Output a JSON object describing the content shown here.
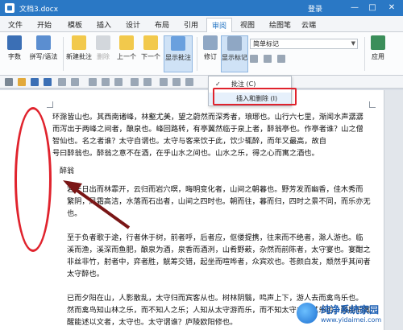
{
  "titlebar": {
    "doc_title": "文档3.docx",
    "login_label": "登录",
    "minimize": "—",
    "maximize": "□",
    "close": "✕"
  },
  "menu": {
    "tabs": [
      "文件",
      "开始",
      "模板",
      "插入",
      "设计",
      "布局",
      "引用",
      "审阅",
      "视图",
      "绘图笔",
      "云端"
    ],
    "active": "审阅"
  },
  "ribbon": {
    "buttons": [
      {
        "label": "字数",
        "icon": "word-count-icon"
      },
      {
        "label": "拼写/语法",
        "icon": "spell-check-icon"
      },
      {
        "label": "新建批注",
        "icon": "new-comment-icon"
      },
      {
        "label": "删除",
        "icon": "delete-comment-icon"
      },
      {
        "label": "上一个",
        "icon": "previous-comment-icon"
      },
      {
        "label": "下一个",
        "icon": "next-comment-icon"
      },
      {
        "label": "显示批注",
        "icon": "show-comments-icon"
      },
      {
        "label": "修订",
        "icon": "track-changes-icon"
      },
      {
        "label": "显示标记",
        "icon": "show-markup-icon"
      },
      {
        "label": "应用",
        "icon": "accept-icon"
      }
    ],
    "markup_select_value": "简单标记"
  },
  "dropdown": {
    "items": [
      {
        "label": "批注 (C)",
        "checked": true
      },
      {
        "label": "插入和删除 (I)",
        "checked": false
      }
    ]
  },
  "document": {
    "para1": [
      "环滁皆山也。其西南诸峰，林壑尤美，望之蔚然而深秀者，琅琊也。山行六七里，渐闻水声潺潺",
      "而泻出于两峰之间者，酿泉也。峰回路转，有亭翼然临于泉上者，醉翁亭也。作亭者谁？山之僧",
      "智仙也。名之者谁？太守自谓也。太守与客来饮于此，饮少辄醉，而年又最高，故自",
      "号曰醉翁也。醉翁之意不在酒，在乎山水之间也。山水之乐，得之心而寓之酒也。"
    ],
    "signature": "醉翁",
    "para2": [
      "若夫日出而林霏开，云归而岩穴暝，晦明变化者，山间之朝暮也。野芳发而幽香，佳木秀而",
      "繁阴，风霜高洁，水落而石出者，山间之四时也。朝而往，暮而归，四时之景不同，而乐亦无穷",
      "也。"
    ],
    "para3": [
      "至于负者歌于途，行者休于树，前者呼，后者应，伛偻提携，往来而不绝者，滁人游也。临",
      "溪而渔，溪深而鱼肥，酿泉为酒，泉香而酒洌，山肴野蔌，杂然而前陈者，太守宴也。宴酣之乐，",
      "非丝非竹，射者中，弈者胜，觥筹交错，起坐而喧哗者，众宾欢也。苍颜白发，颓然乎其间者，",
      "太守醉也。"
    ],
    "para4": [
      "已而夕阳在山，人影散乱，太守归而宾客从也。树林阴翳，鸣声上下，游人去而禽鸟乐也。",
      "然而禽鸟知山林之乐，而不知人之乐；人知从太守游而乐，而不知太守之乐其乐也。醉能同其乐，",
      "醒能述以文者，太守也。太守谓谁？庐陵欧阳修也。"
    ]
  },
  "watermark": {
    "name": "纯净系统家园",
    "url": "www.yidaimei.com"
  },
  "colors": {
    "titlebar": "#2a78c5",
    "annotation_red": "#e0232d",
    "dropdown_highlight": "#e6f0fb"
  }
}
